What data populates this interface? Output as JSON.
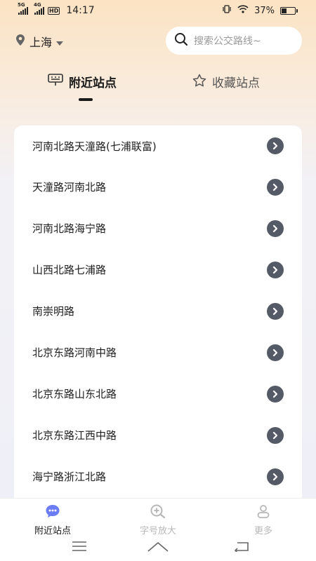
{
  "status_bar": {
    "network1": "5G",
    "network2": "4G",
    "hd_badge": "HD",
    "time": "14:17",
    "battery": "37%",
    "battery_level": 0.37
  },
  "header": {
    "city": "上海",
    "search_placeholder": "搜索公交路线~"
  },
  "tabs": [
    {
      "label": "附近站点",
      "active": true
    },
    {
      "label": "收藏站点",
      "active": false
    }
  ],
  "stations": [
    {
      "name": "河南北路天潼路(七浦联富)"
    },
    {
      "name": "天潼路河南北路"
    },
    {
      "name": "河南北路海宁路"
    },
    {
      "name": "山西北路七浦路"
    },
    {
      "name": "南崇明路"
    },
    {
      "name": "北京东路河南中路"
    },
    {
      "name": "北京东路山东北路"
    },
    {
      "name": "北京东路江西中路"
    },
    {
      "name": "海宁路浙江北路"
    }
  ],
  "bottom_nav": [
    {
      "label": "附近站点",
      "icon": "bus-stop-icon",
      "active": true
    },
    {
      "label": "字号放大",
      "icon": "zoom-in-icon",
      "active": false
    },
    {
      "label": "更多",
      "icon": "person-icon",
      "active": false
    }
  ],
  "colors": {
    "accent": "#6b7cf5",
    "arrow_button": "#555b66",
    "inactive": "#b8b8b8"
  }
}
